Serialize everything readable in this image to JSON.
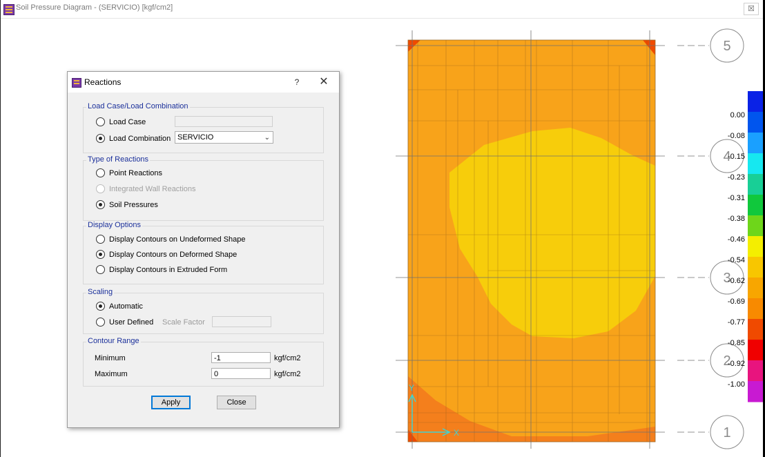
{
  "window": {
    "title": "Soil Pressure Diagram - (SERVICIO)  [kgf/cm2]",
    "close_glyph": "☒"
  },
  "dialog": {
    "title": "Reactions",
    "help_glyph": "?",
    "close_glyph": "✕",
    "load": {
      "group_title": "Load Case/Load Combination",
      "load_case_label": "Load Case",
      "load_case_value": "",
      "load_combination_label": "Load Combination",
      "load_combination_value": "SERVICIO",
      "selected": "Load Combination"
    },
    "reaction_type": {
      "group_title": "Type of Reactions",
      "options": [
        "Point Reactions",
        "Integrated Wall Reactions",
        "Soil Pressures"
      ],
      "selected": "Soil Pressures",
      "disabled": [
        "Integrated Wall Reactions"
      ]
    },
    "display": {
      "group_title": "Display Options",
      "options": [
        "Display Contours on Undeformed Shape",
        "Display Contours on Deformed Shape",
        "Display Contours in Extruded Form"
      ],
      "selected": "Display Contours on Deformed Shape"
    },
    "scaling": {
      "group_title": "Scaling",
      "automatic_label": "Automatic",
      "user_defined_label": "User Defined",
      "scale_factor_label": "Scale Factor",
      "scale_factor_value": "",
      "selected": "Automatic"
    },
    "contour": {
      "group_title": "Contour Range",
      "minimum_label": "Minimum",
      "minimum_value": "-1",
      "maximum_label": "Maximum",
      "maximum_value": "0",
      "unit": "kgf/cm2"
    },
    "buttons": {
      "apply": "Apply",
      "close": "Close"
    }
  },
  "grid_labels": [
    "5",
    "4",
    "3",
    "2",
    "1"
  ],
  "legend": {
    "values": [
      "0.00",
      "-0.08",
      "-0.15",
      "-0.23",
      "-0.31",
      "-0.38",
      "-0.46",
      "-0.54",
      "-0.62",
      "-0.69",
      "-0.77",
      "-0.85",
      "-0.92",
      "-1.00"
    ],
    "colors": [
      "#0a22e6",
      "#0055ee",
      "#1aa0ff",
      "#16e8f0",
      "#18cf96",
      "#10c83c",
      "#6ed61a",
      "#f4ee00",
      "#f8c600",
      "#f8a600",
      "#f88a00",
      "#f04a00",
      "#f00000",
      "#e8147e",
      "#c81ad2"
    ]
  },
  "contour_colors": {
    "outer": "#f47f1c",
    "mid": "#f8a31a",
    "inner": "#f7cd0b"
  },
  "axis_labels": {
    "y": "Y",
    "x": "X"
  }
}
